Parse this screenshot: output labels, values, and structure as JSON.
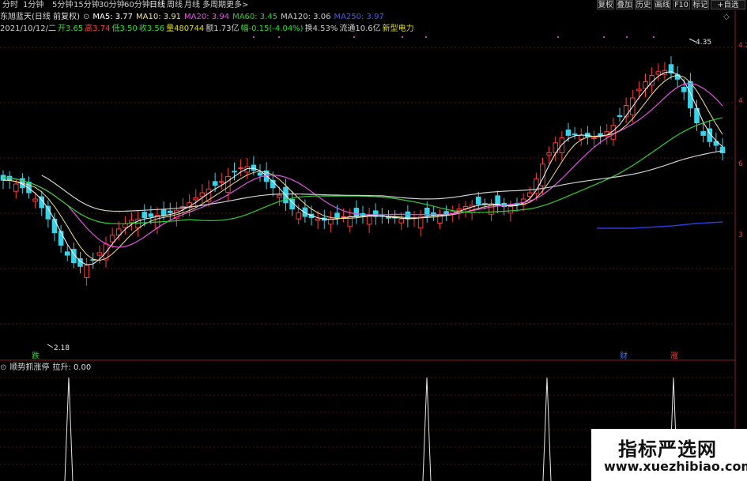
{
  "toolbar": {
    "periods": [
      "分时",
      "1分钟",
      "5分钟",
      "15分钟",
      "30分钟",
      "60分钟",
      "日线",
      "周线",
      "月线",
      "多周期",
      "更多>"
    ],
    "active_period": "日线",
    "tools": [
      "复权",
      "叠加",
      "历史",
      "画线",
      "F10",
      "标记",
      "+自选"
    ]
  },
  "header": {
    "stock": "东旭蓝天(日线 前复权)",
    "ma": [
      {
        "label": "MA5: 3.77",
        "color": "#ffffff"
      },
      {
        "label": "MA10: 3.91",
        "color": "#f2e08c"
      },
      {
        "label": "MA20: 3.94",
        "color": "#e055e0"
      },
      {
        "label": "MA60: 3.45",
        "color": "#33cc33"
      },
      {
        "label": "MA120: 3.06",
        "color": "#cfcfcf"
      },
      {
        "label": "MA250: 3.97",
        "color": "#3a5bff"
      }
    ],
    "bar": [
      {
        "t": "2021/10/12/二",
        "c": "#cfcfcf"
      },
      {
        "t": "开3.65",
        "c": "#33dd33"
      },
      {
        "t": "高3.74",
        "c": "#ff4040"
      },
      {
        "t": "低3.50",
        "c": "#33dd33"
      },
      {
        "t": "收3.56",
        "c": "#33dd33"
      },
      {
        "t": "量480744",
        "c": "#dddd33"
      },
      {
        "t": "额1.73亿",
        "c": "#cfcfcf"
      },
      {
        "t": "幅-0.15(-4.04%)",
        "c": "#33dd33"
      },
      {
        "t": "换4.53%",
        "c": "#cfcfcf"
      },
      {
        "t": "流通10.6亿",
        "c": "#cfcfcf"
      },
      {
        "t": "新型电力",
        "c": "#dddd33"
      }
    ]
  },
  "markers": {
    "high": "4.35",
    "low": "2.18",
    "events": [
      {
        "t": "跌",
        "c": "#33cc33"
      },
      {
        "t": "财",
        "c": "#3a7bff"
      },
      {
        "t": "涨",
        "c": "#ff4040"
      }
    ]
  },
  "y_right": [
    "4.2",
    "4",
    "6",
    "3"
  ],
  "indicator": {
    "name": "顺势抓涨停",
    "value": "拉升: 0.00",
    "spikes": [
      87,
      540,
      692,
      852
    ]
  },
  "watermark": {
    "line1": "指标严选网",
    "line2": "www.xuezhibiao.com"
  },
  "chart_data": {
    "type": "candlestick",
    "title": "东旭蓝天(日线 前复权)",
    "last_bar": {
      "open": 3.65,
      "high": 3.74,
      "low": 3.5,
      "close": 3.56,
      "volume": 480744
    },
    "moving_averages": {
      "MA5": 3.77,
      "MA10": 3.91,
      "MA20": 3.94,
      "MA60": 3.45,
      "MA120": 3.06,
      "MA250": 3.97
    },
    "range": {
      "low": 2.18,
      "high": 4.35
    },
    "price_series": [
      3.34,
      3.34,
      3.31,
      3.28,
      3.24,
      3.19,
      3.12,
      3.03,
      2.92,
      2.82,
      2.74,
      2.68,
      2.65,
      2.66,
      2.7,
      2.76,
      2.83,
      2.9,
      2.95,
      2.99,
      3.02,
      3.03,
      3.04,
      3.05,
      3.06,
      3.06,
      3.08,
      3.1,
      3.13,
      3.16,
      3.2,
      3.24,
      3.27,
      3.3,
      3.33,
      3.37,
      3.41,
      3.44,
      3.45,
      3.42,
      3.38,
      3.33,
      3.28,
      3.22,
      3.16,
      3.11,
      3.08,
      3.05,
      3.04,
      3.03,
      3.02,
      3.03,
      3.04,
      3.05,
      3.05,
      3.05,
      3.06,
      3.06,
      3.05,
      3.05,
      3.04,
      3.04,
      3.03,
      3.03,
      3.04,
      3.05,
      3.06,
      3.06,
      3.06,
      3.07,
      3.09,
      3.11,
      3.13,
      3.14,
      3.15,
      3.15,
      3.15,
      3.14,
      3.13,
      3.13,
      3.15,
      3.19,
      3.24,
      3.35,
      3.47,
      3.56,
      3.64,
      3.68,
      3.7,
      3.71,
      3.7,
      3.69,
      3.68,
      3.7,
      3.73,
      3.78,
      3.85,
      3.94,
      4.0,
      4.07,
      4.13,
      4.18,
      4.21,
      4.22,
      4.2,
      4.15,
      4.05,
      3.92,
      3.8,
      3.7,
      3.65,
      3.62,
      3.56
    ]
  }
}
